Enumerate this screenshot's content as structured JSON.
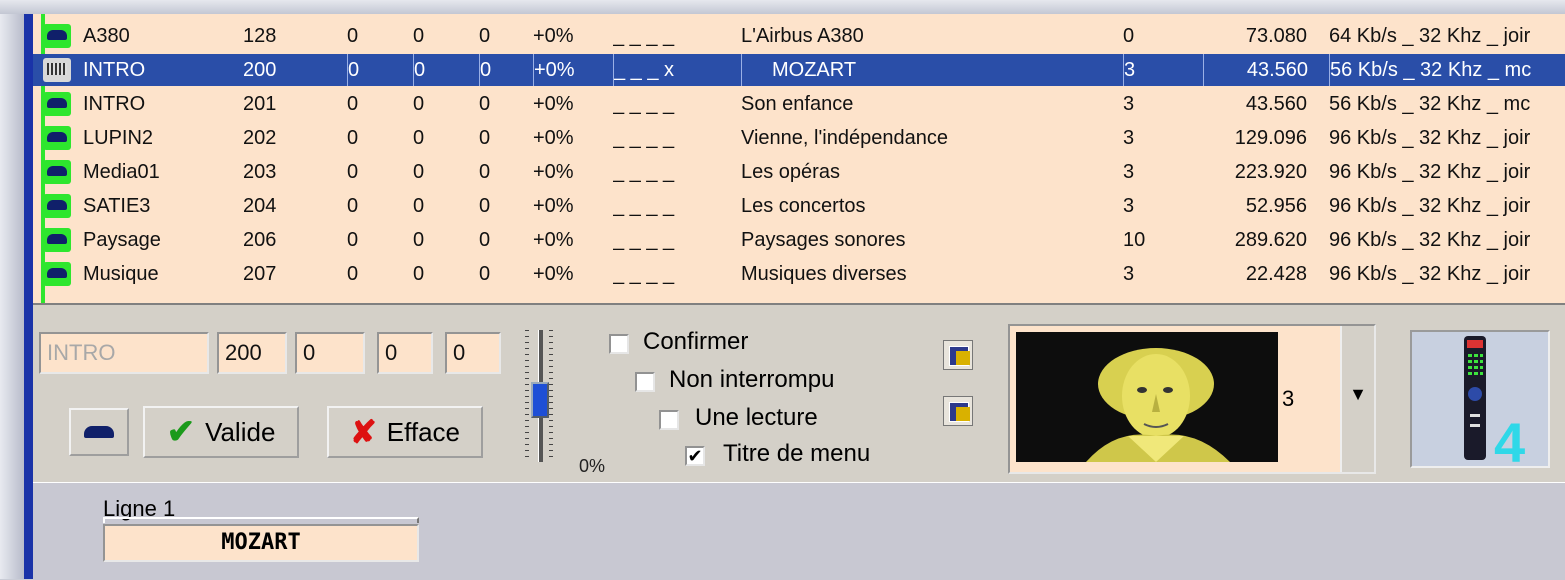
{
  "list": {
    "rows": [
      {
        "name": "A380",
        "num": "128",
        "a": "0",
        "b": "0",
        "c": "0",
        "pct": "+0%",
        "flags": "_ _ _ _",
        "title": "L'Airbus A380",
        "cnt": "0",
        "size": "73.080",
        "fmt": "64 Kb/s _ 32 Khz _ joir",
        "selected": false
      },
      {
        "name": "INTRO",
        "num": "200",
        "a": "0",
        "b": "0",
        "c": "0",
        "pct": "+0%",
        "flags": "_ _ _ x",
        "title": "MOZART",
        "cnt": "3",
        "size": "43.560",
        "fmt": "56 Kb/s _ 32 Khz _ mc",
        "selected": true
      },
      {
        "name": "INTRO",
        "num": "201",
        "a": "0",
        "b": "0",
        "c": "0",
        "pct": "+0%",
        "flags": "_ _ _ _",
        "title": "Son enfance",
        "cnt": "3",
        "size": "43.560",
        "fmt": "56 Kb/s _ 32 Khz _ mc",
        "selected": false
      },
      {
        "name": "LUPIN2",
        "num": "202",
        "a": "0",
        "b": "0",
        "c": "0",
        "pct": "+0%",
        "flags": "_ _ _ _",
        "title": "Vienne, l'indépendance",
        "cnt": "3",
        "size": "129.096",
        "fmt": "96 Kb/s _ 32 Khz _ joir",
        "selected": false
      },
      {
        "name": "Media01",
        "num": "203",
        "a": "0",
        "b": "0",
        "c": "0",
        "pct": "+0%",
        "flags": "_ _ _ _",
        "title": "Les opéras",
        "cnt": "3",
        "size": "223.920",
        "fmt": "96 Kb/s _ 32 Khz _ joir",
        "selected": false
      },
      {
        "name": "SATIE3",
        "num": "204",
        "a": "0",
        "b": "0",
        "c": "0",
        "pct": "+0%",
        "flags": "_ _ _ _",
        "title": "Les concertos",
        "cnt": "3",
        "size": "52.956",
        "fmt": "96 Kb/s _ 32 Khz _ joir",
        "selected": false
      },
      {
        "name": "Paysage",
        "num": "206",
        "a": "0",
        "b": "0",
        "c": "0",
        "pct": "+0%",
        "flags": "_ _ _ _",
        "title": "Paysages sonores",
        "cnt": "10",
        "size": "289.620",
        "fmt": "96 Kb/s _ 32 Khz _ joir",
        "selected": false
      },
      {
        "name": "Musique",
        "num": "207",
        "a": "0",
        "b": "0",
        "c": "0",
        "pct": "+0%",
        "flags": "_ _ _ _",
        "title": "Musiques diverses",
        "cnt": "3",
        "size": "22.428",
        "fmt": "96 Kb/s _ 32 Khz _ joir",
        "selected": false
      }
    ]
  },
  "editor": {
    "name_value": "INTRO",
    "num_value": "200",
    "v1": "0",
    "v2": "0",
    "v3": "0",
    "valide_label": "Valide",
    "efface_label": "Efface",
    "slider_pct_label": "0%",
    "slider_level_percent": 0,
    "confirmer_label": "Confirmer",
    "non_interrompu_label": "Non interrompu",
    "une_lecture_label": "Une lecture",
    "titre_menu_label": "Titre de menu",
    "confirmer_checked": false,
    "non_interrompu_checked": false,
    "une_lecture_checked": false,
    "titre_menu_checked": true,
    "image_combo_value": "3",
    "remote_digit": "4"
  },
  "ligne": {
    "label": "Ligne 1",
    "value": "MOZART"
  },
  "colors": {
    "row_bg": "#fde3cb",
    "selection": "#2a4ea8",
    "icon_green": "#2ee62e",
    "accent_blue": "#1a33a8"
  }
}
